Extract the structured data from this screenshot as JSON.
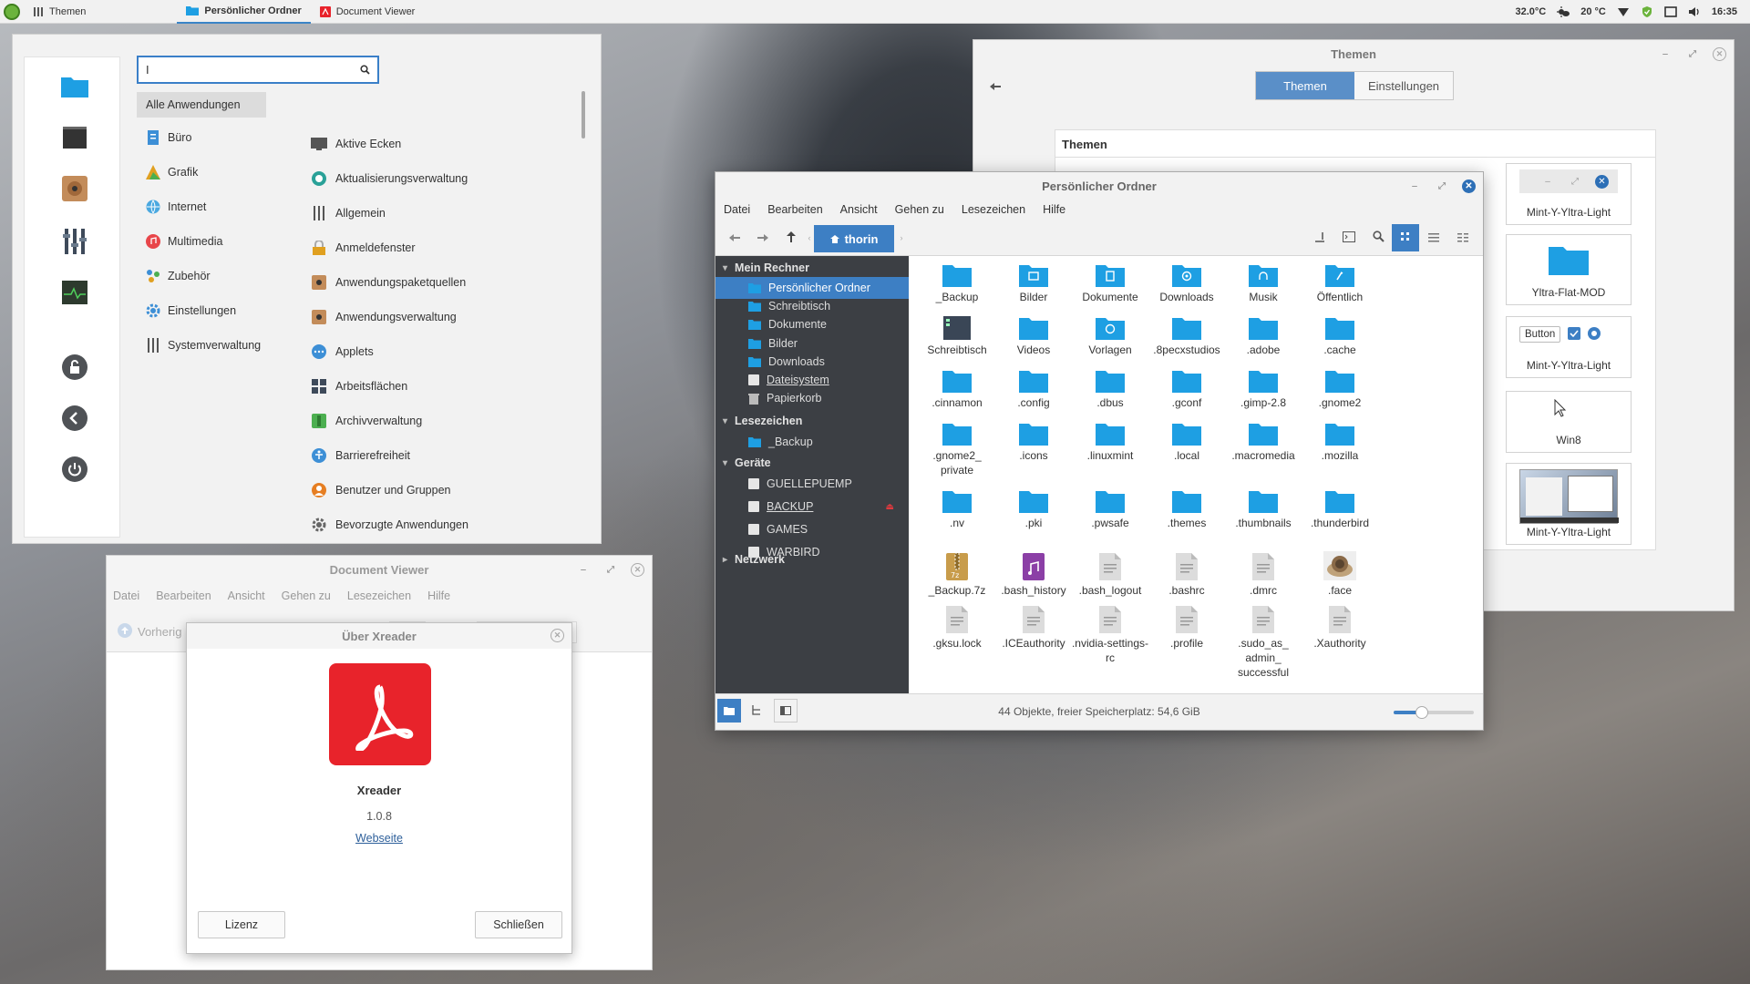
{
  "panel": {
    "tasks": [
      "Themen",
      "Persönlicher Ordner",
      "Document Viewer"
    ],
    "temp_cpu": "32.0°C",
    "temp_weather": "20 °C",
    "clock": "16:35"
  },
  "start_menu": {
    "search_value": "I",
    "categories": [
      "Alle Anwendungen",
      "Büro",
      "Grafik",
      "Internet",
      "Multimedia",
      "Zubehör",
      "Einstellungen",
      "Systemverwaltung"
    ],
    "apps": [
      "Aktive Ecken",
      "Aktualisierungsverwaltung",
      "Allgemein",
      "Anmeldefenster",
      "Anwendungspaketquellen",
      "Anwendungsverwaltung",
      "Applets",
      "Arbeitsflächen",
      "Archivverwaltung",
      "Barrierefreiheit",
      "Benutzer und Gruppen",
      "Bevorzugte Anwendungen"
    ]
  },
  "themen_window": {
    "title": "Themen",
    "tabs": [
      "Themen",
      "Einstellungen"
    ],
    "section_header": "Themen",
    "cards": [
      "Mint-Y-Yltra-Light",
      "Yltra-Flat-MOD",
      "Mint-Y-Yltra-Light",
      "Win8",
      "Mint-Y-Yltra-Light"
    ],
    "preview_button_label": "Button"
  },
  "nemo": {
    "title": "Persönlicher Ordner",
    "menu": [
      "Datei",
      "Bearbeiten",
      "Ansicht",
      "Gehen zu",
      "Lesezeichen",
      "Hilfe"
    ],
    "breadcrumb": "thorin",
    "sidebar": {
      "section_computer": "Mein Rechner",
      "computer_items": [
        "Persönlicher Ordner",
        "Schreibtisch",
        "Dokumente",
        "Bilder",
        "Downloads",
        "Dateisystem",
        "Papierkorb"
      ],
      "section_bookmarks": "Lesezeichen",
      "bookmark_items": [
        "_Backup"
      ],
      "section_devices": "Geräte",
      "device_items": [
        "GUELLEPUEMP",
        "BACKUP",
        "GAMES",
        "WARBIRD"
      ],
      "section_network": "Netzwerk"
    },
    "files": [
      {
        "name": "_Backup",
        "type": "folder"
      },
      {
        "name": "Bilder",
        "type": "folder-pictures"
      },
      {
        "name": "Dokumente",
        "type": "folder-documents"
      },
      {
        "name": "Downloads",
        "type": "folder-download"
      },
      {
        "name": "Musik",
        "type": "folder-music"
      },
      {
        "name": "Öffentlich",
        "type": "folder-public"
      },
      {
        "name": "Schreibtisch",
        "type": "folder-desktop"
      },
      {
        "name": "Videos",
        "type": "folder"
      },
      {
        "name": "Vorlagen",
        "type": "folder-templates"
      },
      {
        "name": ".8pecxstudios",
        "type": "folder"
      },
      {
        "name": ".adobe",
        "type": "folder"
      },
      {
        "name": ".cache",
        "type": "folder"
      },
      {
        "name": ".cinnamon",
        "type": "folder"
      },
      {
        "name": ".config",
        "type": "folder"
      },
      {
        "name": ".dbus",
        "type": "folder"
      },
      {
        "name": ".gconf",
        "type": "folder"
      },
      {
        "name": ".gimp-2.8",
        "type": "folder"
      },
      {
        "name": ".gnome2",
        "type": "folder"
      },
      {
        "name": ".gnome2_\nprivate",
        "type": "folder"
      },
      {
        "name": ".icons",
        "type": "folder"
      },
      {
        "name": ".linuxmint",
        "type": "folder"
      },
      {
        "name": ".local",
        "type": "folder"
      },
      {
        "name": ".macromedia",
        "type": "folder"
      },
      {
        "name": ".mozilla",
        "type": "folder"
      },
      {
        "name": ".nv",
        "type": "folder"
      },
      {
        "name": ".pki",
        "type": "folder"
      },
      {
        "name": ".pwsafe",
        "type": "folder"
      },
      {
        "name": ".themes",
        "type": "folder"
      },
      {
        "name": ".thumbnails",
        "type": "folder"
      },
      {
        "name": ".thunderbird",
        "type": "folder"
      },
      {
        "name": "_Backup.7z",
        "type": "archive"
      },
      {
        "name": ".bash_history",
        "type": "audio"
      },
      {
        "name": ".bash_logout",
        "type": "text"
      },
      {
        "name": ".bashrc",
        "type": "text"
      },
      {
        "name": ".dmrc",
        "type": "text"
      },
      {
        "name": ".face",
        "type": "image"
      },
      {
        "name": ".gksu.lock",
        "type": "text"
      },
      {
        "name": ".ICEauthority",
        "type": "text"
      },
      {
        "name": ".nvidia-settings-\nrc",
        "type": "text"
      },
      {
        "name": ".profile",
        "type": "text"
      },
      {
        "name": ".sudo_as_\nadmin_\nsuccessful",
        "type": "text"
      },
      {
        "name": ".Xauthority",
        "type": "text"
      }
    ],
    "status": "44 Objekte, freier Speicherplatz: 54,6 GiB",
    "zoom_level": 0.35
  },
  "docviewer": {
    "title": "Document Viewer",
    "menu": [
      "Datei",
      "Bearbeiten",
      "Ansicht",
      "Gehen zu",
      "Lesezeichen",
      "Hilfe"
    ],
    "prev_label": "Vorherig"
  },
  "about": {
    "title": "Über Xreader",
    "app_name": "Xreader",
    "version": "1.0.8",
    "website_label": "Webseite",
    "license_button": "Lizenz",
    "close_button": "Schließen"
  },
  "colors": {
    "accent": "#3d7fc4",
    "folder": "#1e9fe3",
    "sidebar_bg": "#3c3f44",
    "acrobat_red": "#e8232b"
  }
}
